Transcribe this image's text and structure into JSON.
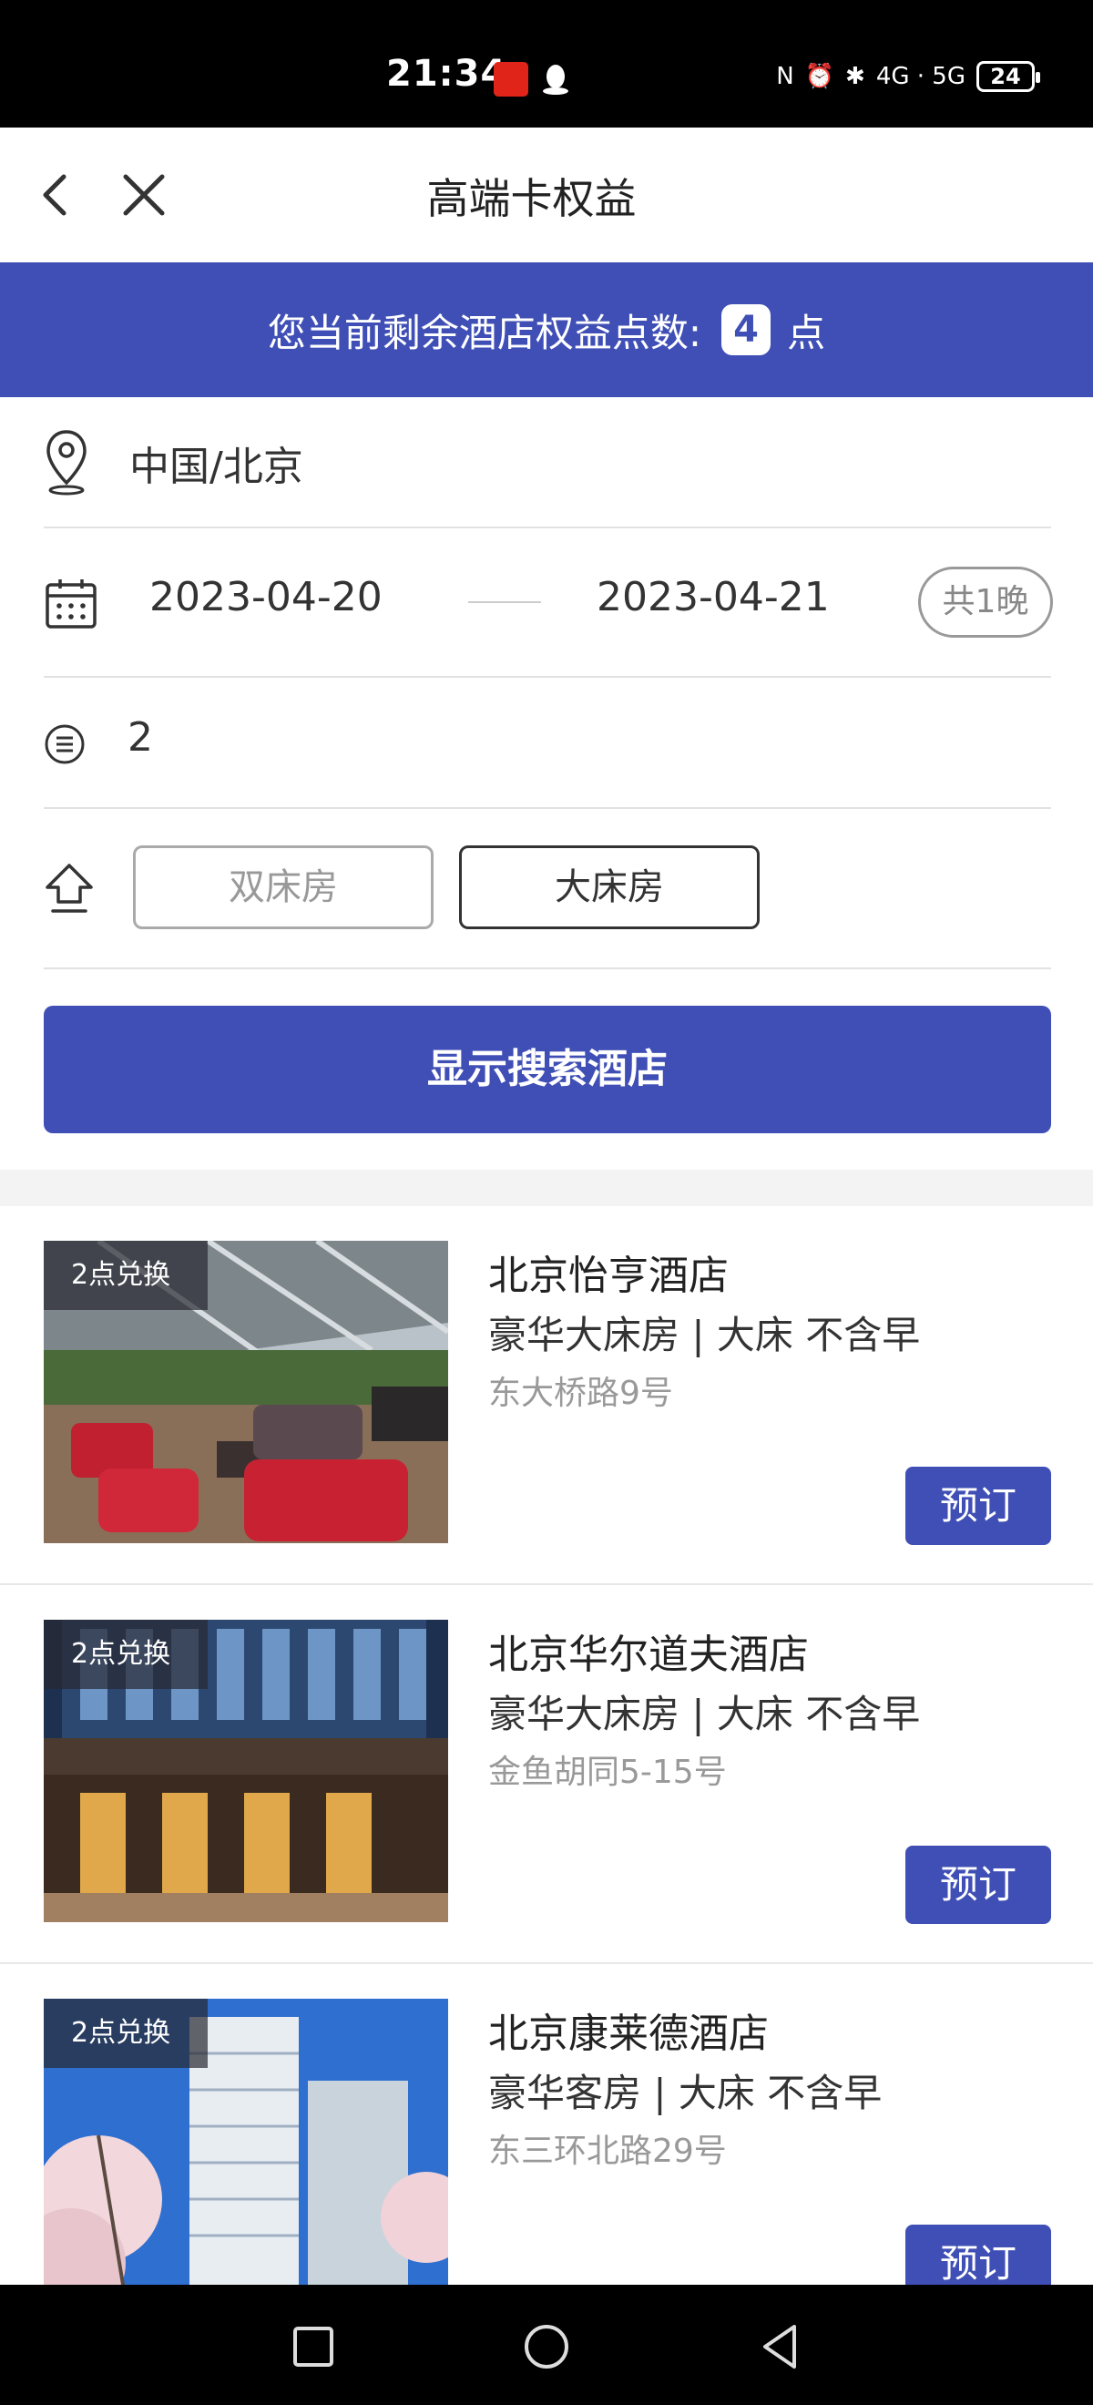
{
  "status_bar": {
    "time": "21:34",
    "battery": "24",
    "network": "4G · 5G"
  },
  "header": {
    "title": "高端卡权益"
  },
  "points_banner": {
    "label": "您当前剩余酒店权益点数:",
    "points": "4",
    "unit": "点"
  },
  "search": {
    "location": "中国/北京",
    "check_in": "2023-04-20",
    "check_out": "2023-04-21",
    "nights": "共1晚",
    "guests": "2",
    "room_types": [
      "双床房",
      "大床房"
    ],
    "selected_room_type": "大床房",
    "search_button": "显示搜索酒店"
  },
  "hotels": [
    {
      "tag": "2点兑换",
      "name": "北京怡亨酒店",
      "room": "豪华大床房 | 大床 不含早",
      "address": "东大桥路9号",
      "book_label": "预订"
    },
    {
      "tag": "2点兑换",
      "name": "北京华尔道夫酒店",
      "room": "豪华大床房 | 大床 不含早",
      "address": "金鱼胡同5-15号",
      "book_label": "预订"
    },
    {
      "tag": "2点兑换",
      "name": "北京康莱德酒店",
      "room": "豪华客房 | 大床 不含早",
      "address": "东三环北路29号",
      "book_label": "预订"
    }
  ],
  "colors": {
    "accent": "#3f4fb5",
    "divider": "#e2e2e2"
  },
  "icons": {
    "nav": [
      "back-icon",
      "close-icon"
    ],
    "form": [
      "location-pin-icon",
      "calendar-icon",
      "list-icon",
      "home-icon"
    ],
    "system": [
      "recent-apps-icon",
      "home-circle-icon",
      "back-triangle-icon"
    ]
  }
}
